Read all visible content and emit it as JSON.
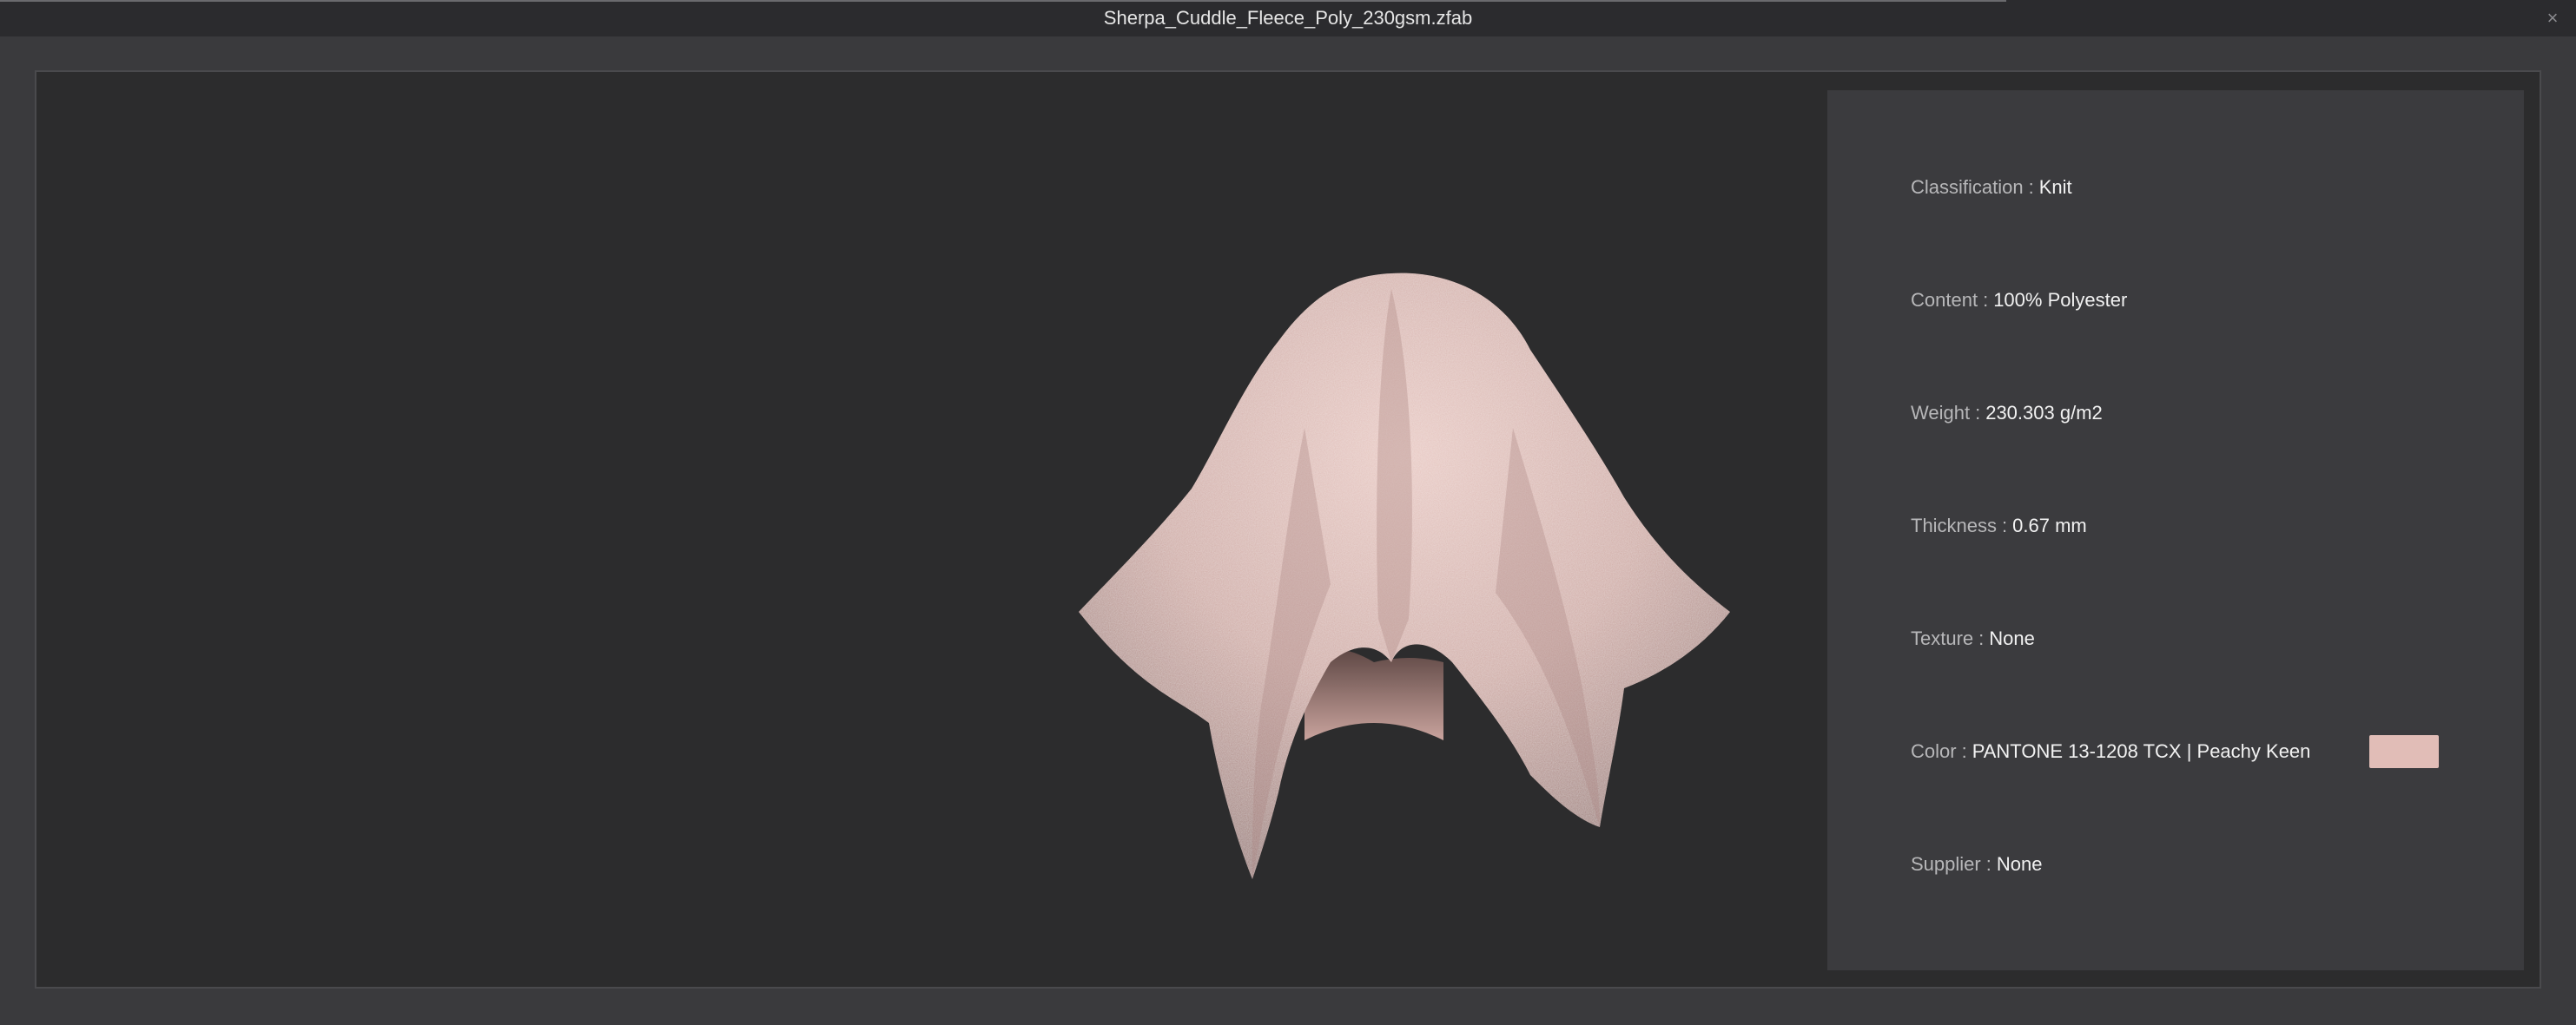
{
  "window": {
    "title": "Sherpa_Cuddle_Fleece_Poly_230gsm.zfab",
    "close_glyph": "×"
  },
  "viewport": {
    "preview": "draped-fabric-sphere",
    "fabric_color": "#e1bdb7"
  },
  "info": {
    "separator": ":",
    "rows": [
      {
        "label": "Classification",
        "value": "Knit"
      },
      {
        "label": "Content",
        "value": "100% Polyester"
      },
      {
        "label": "Weight",
        "value": "230.303 g/m2"
      },
      {
        "label": "Thickness",
        "value": "0.67 mm"
      },
      {
        "label": "Texture",
        "value": "None"
      },
      {
        "label": "Color",
        "value": "PANTONE 13-1208 TCX | Peachy Keen"
      },
      {
        "label": "Supplier",
        "value": "None"
      }
    ],
    "color_swatch": "#e1bdb7"
  }
}
